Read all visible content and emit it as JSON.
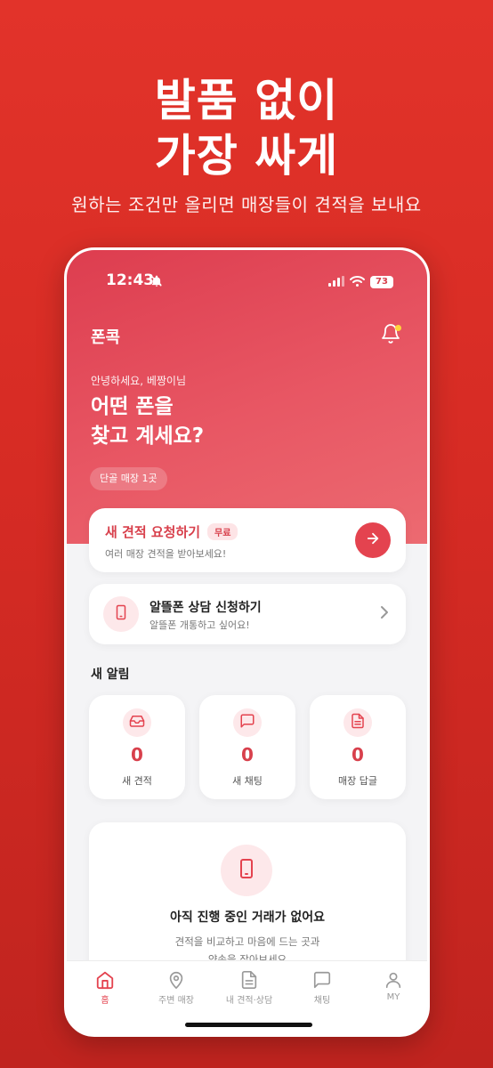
{
  "hero": {
    "title_line1": "발품 없이",
    "title_line2": "가장 싸게",
    "subtitle": "원하는 조건만 올리면 매장들이 견적을 보내요"
  },
  "status_bar": {
    "time": "12:43",
    "battery": "73"
  },
  "app": {
    "title": "폰콕",
    "greeting": "안녕하세요, 베짱이님",
    "headline_line1": "어떤 폰을",
    "headline_line2": "찾고 계세요?",
    "store_chip": "단골 매장 1곳"
  },
  "estimate_card": {
    "title": "새 견적 요청하기",
    "badge": "무료",
    "description": "여러 매장 견적을 받아보세요!"
  },
  "budget_card": {
    "title": "알뜰폰 상담 신청하기",
    "description": "알뜰폰 개통하고 싶어요!"
  },
  "notifications": {
    "section_title": "새 알림",
    "items": [
      {
        "icon": "inbox-icon",
        "count": "0",
        "label": "새 견적"
      },
      {
        "icon": "chat-bubble-icon",
        "count": "0",
        "label": "새 채팅"
      },
      {
        "icon": "document-icon",
        "count": "0",
        "label": "매장 답글"
      }
    ]
  },
  "empty_state": {
    "title": "아직 진행 중인 거래가 없어요",
    "desc_line1": "견적을 비교하고 마음에 드는 곳과",
    "desc_line2": "약속을 잡아보세요"
  },
  "tabbar": {
    "tabs": [
      {
        "icon": "home-icon",
        "label": "홈",
        "active": true
      },
      {
        "icon": "location-pin-icon",
        "label": "주변 매장",
        "active": false
      },
      {
        "icon": "document-icon",
        "label": "내 견적·상담",
        "active": false
      },
      {
        "icon": "chat-bubble-icon",
        "label": "채팅",
        "active": false
      },
      {
        "icon": "person-icon",
        "label": "MY",
        "active": false
      }
    ]
  },
  "colors": {
    "brand_red": "#e4434f",
    "background_red": "#d62b24",
    "badge_bg": "#fde4e6"
  }
}
